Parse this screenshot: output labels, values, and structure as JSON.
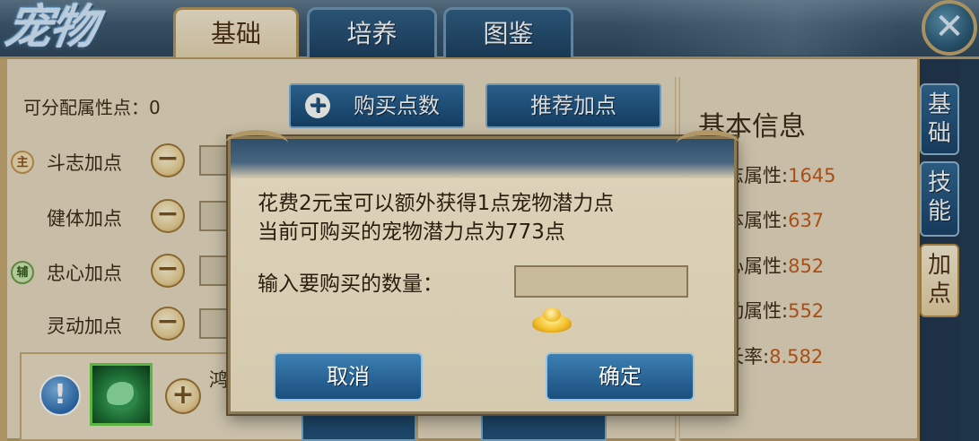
{
  "header": {
    "title": "宠物",
    "tabs": [
      {
        "label": "基础",
        "active": true
      },
      {
        "label": "培养",
        "active": false
      },
      {
        "label": "图鉴",
        "active": false
      }
    ],
    "close_glyph": "✕"
  },
  "left_panel": {
    "allocatable_label": "可分配属性点：0",
    "buy_points_label": "购买点数",
    "recommend_label": "推荐加点",
    "attributes": [
      {
        "badge": "主",
        "label": "斗志加点"
      },
      {
        "badge": "",
        "label": "健体加点"
      },
      {
        "badge": "辅",
        "label": "忠心加点"
      },
      {
        "badge": "",
        "label": "灵动加点"
      }
    ],
    "pet_name_partial": "鸿"
  },
  "right_panel": {
    "title": "基本信息",
    "stats": [
      {
        "label": "志属性:",
        "value": "1645"
      },
      {
        "label": "体属性:",
        "value": "637"
      },
      {
        "label": "心属性:",
        "value": "852"
      },
      {
        "label": "动属性:",
        "value": "552"
      },
      {
        "label": "长率:",
        "value": "8.582"
      }
    ]
  },
  "side_tabs": [
    {
      "label": "基础",
      "active": false
    },
    {
      "label": "技能",
      "active": false
    },
    {
      "label": "加点",
      "active": true
    }
  ],
  "dialog": {
    "line1": "花费2元宝可以额外获得1点宠物潜力点",
    "line2": "当前可购买的宠物潜力点为773点",
    "quantity_label": "输入要购买的数量：",
    "quantity_value": "",
    "cancel_label": "取消",
    "confirm_label": "确定"
  },
  "colors": {
    "accent_blue": "#1b4f7d",
    "parchment": "#e8dcc2",
    "stat_value": "#c05a1c"
  }
}
